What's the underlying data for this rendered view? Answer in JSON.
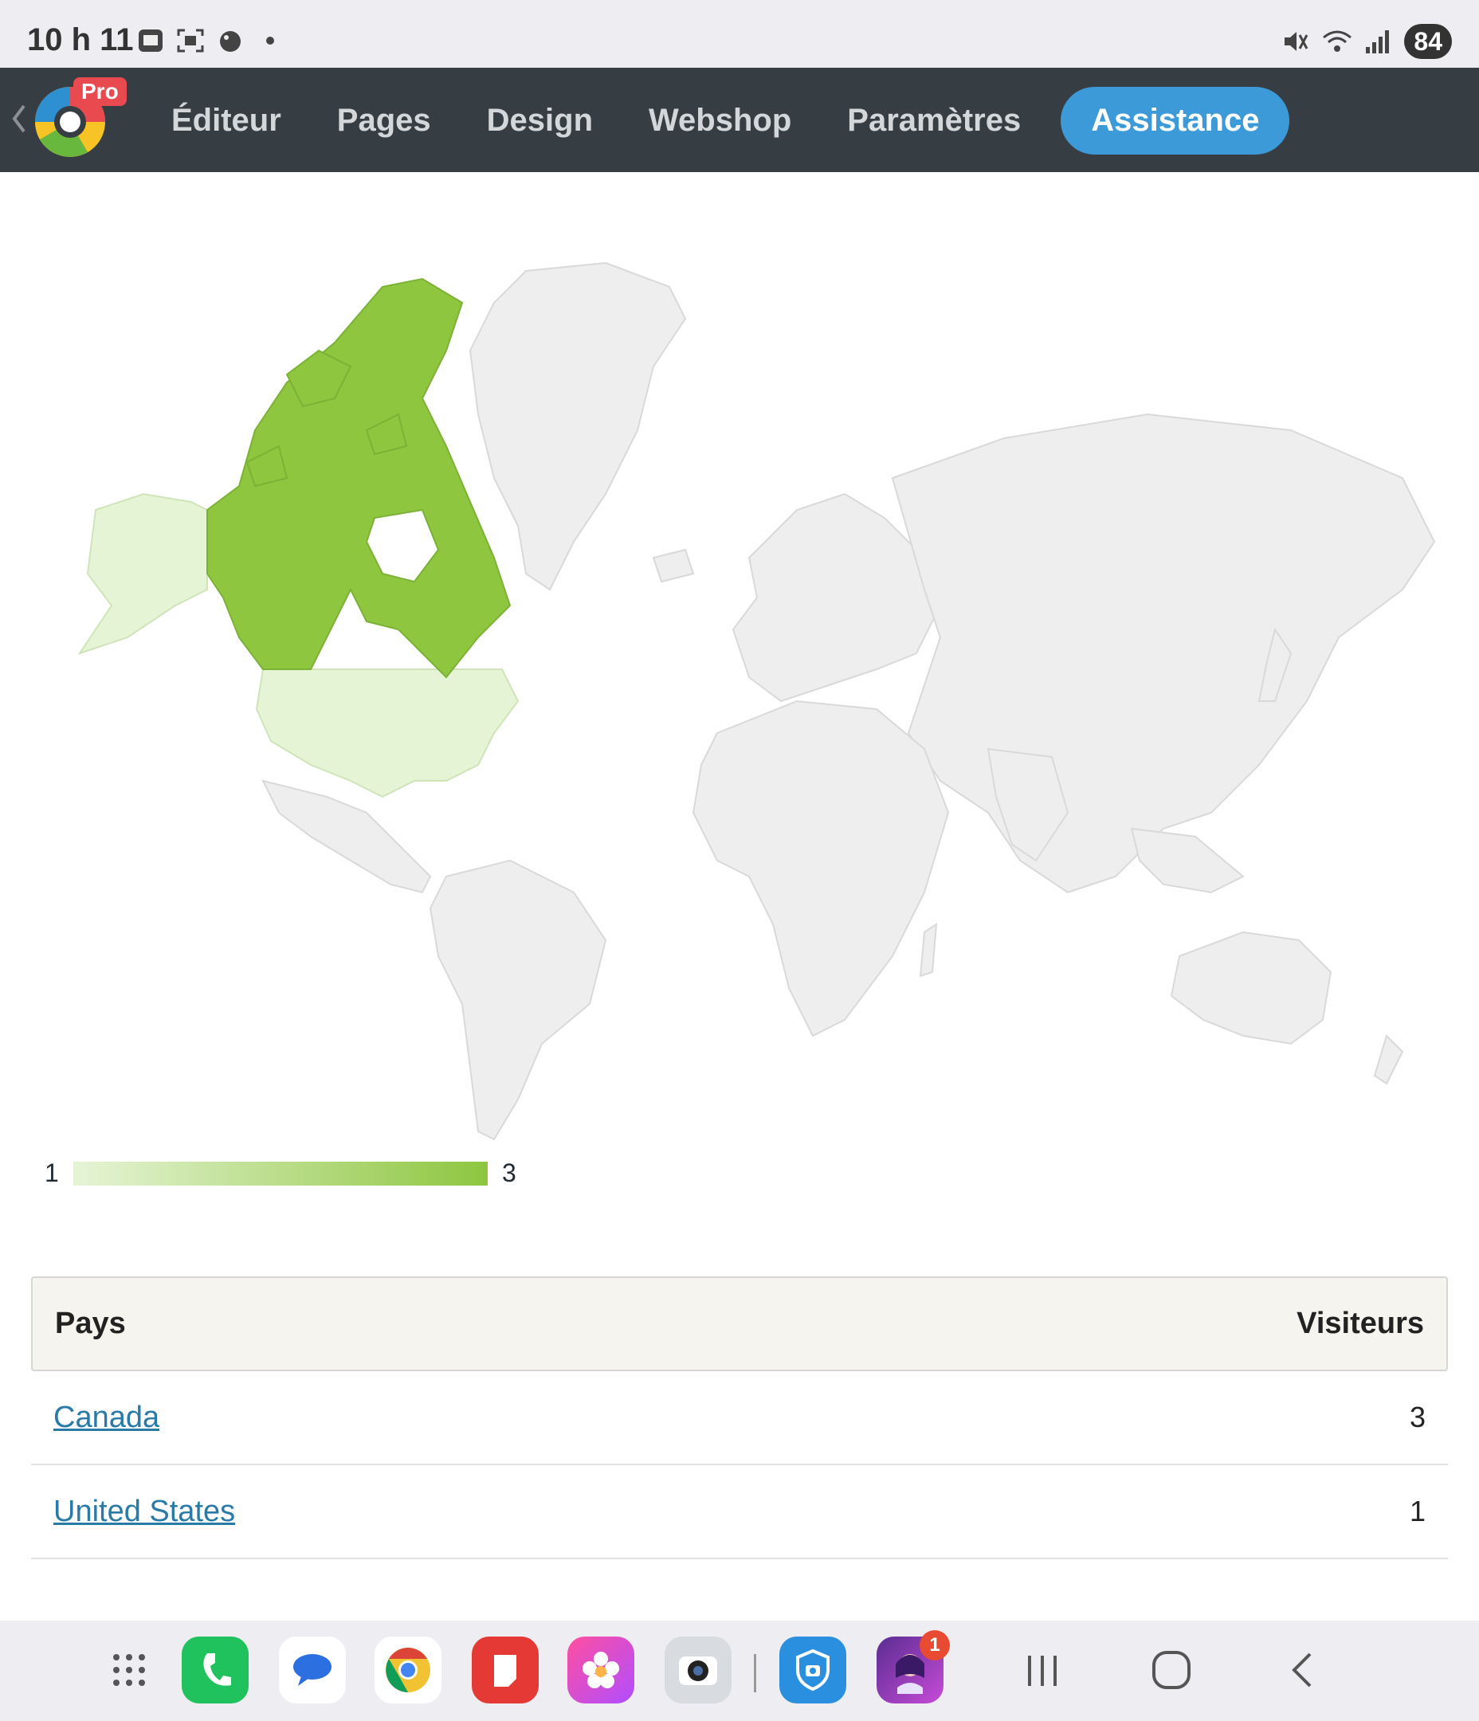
{
  "status_bar": {
    "time": "10 h 11",
    "battery": "84",
    "icons": [
      "sim-icon",
      "screenshot-icon",
      "app-icon",
      "dot-icon",
      "mute-icon",
      "wifi-icon",
      "signal-icon"
    ]
  },
  "navbar": {
    "badge": "Pro",
    "items": [
      {
        "label": "Éditeur"
      },
      {
        "label": "Pages"
      },
      {
        "label": "Design"
      },
      {
        "label": "Webshop"
      },
      {
        "label": "Paramètres"
      },
      {
        "label": "Assistance"
      }
    ],
    "colors": {
      "background": "#373e43",
      "active": "#3d9ad8"
    }
  },
  "map": {
    "highlighted": [
      {
        "country": "Canada",
        "value": 3,
        "color": "#8ec63f"
      },
      {
        "country": "United States",
        "value": 1,
        "color": "#e6f4d6"
      }
    ],
    "legend": {
      "min": "1",
      "max": "3"
    },
    "base_color": "#eeeeee"
  },
  "table": {
    "headers": {
      "country": "Pays",
      "visitors": "Visiteurs"
    },
    "rows": [
      {
        "country": "Canada",
        "visitors": "3"
      },
      {
        "country": "United States",
        "visitors": "1"
      }
    ]
  },
  "dock": {
    "apps": [
      "apps-grid-icon",
      "phone-icon",
      "messages-icon",
      "chrome-icon",
      "notes-icon",
      "gallery-icon",
      "camera-icon",
      "secure-folder-icon",
      "linky-app-icon"
    ],
    "linky_badge": "1",
    "system": [
      "recents-icon",
      "home-icon",
      "back-icon"
    ]
  }
}
